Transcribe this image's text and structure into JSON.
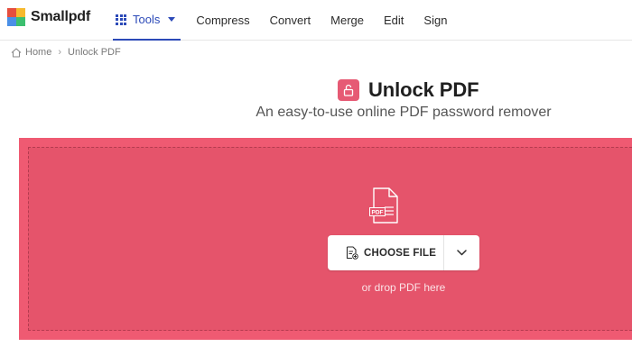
{
  "brand": {
    "name": "Smallpdf",
    "logo_colors": [
      "#e54e3e",
      "#f7b92d",
      "#4a8fe7",
      "#3cbf6f"
    ]
  },
  "nav": {
    "tools_label": "Tools",
    "items": [
      "Compress",
      "Convert",
      "Merge",
      "Edit",
      "Sign"
    ],
    "active": "Tools",
    "accent_color": "#2c4ab8"
  },
  "breadcrumb": {
    "home": "Home",
    "separator": "›",
    "current": "Unlock PDF"
  },
  "page": {
    "title": "Unlock PDF",
    "title_icon": "unlock-icon",
    "subtitle": "An easy-to-use online PDF password remover"
  },
  "dropzone": {
    "file_icon_label": "PDF",
    "choose_file_label": "CHOOSE FILE",
    "drop_hint": "or drop PDF here",
    "color": "#e5546b"
  }
}
